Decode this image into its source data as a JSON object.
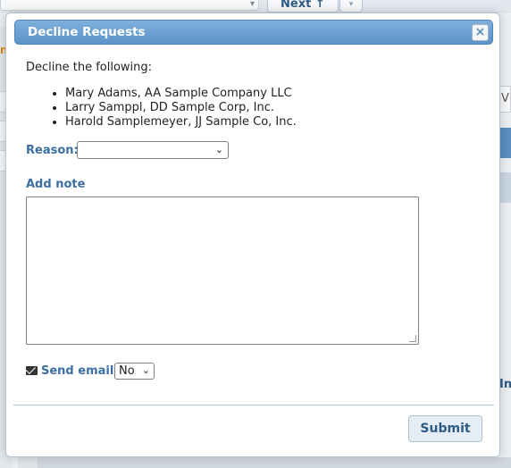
{
  "background": {
    "next_label": "Next",
    "left_orange_text": "ng",
    "right_box_text": "V",
    "right_link_text": "In"
  },
  "modal": {
    "title": "Decline Requests",
    "close_glyph": "×",
    "intro": "Decline the following:",
    "items": [
      "Mary Adams, AA Sample Company LLC",
      "Larry Samppl, DD Sample Corp, Inc.",
      "Harold Samplemeyer, JJ Sample Co, Inc."
    ],
    "reason_label": "Reason:",
    "reason_value": "",
    "note_label": "Add note",
    "note_value": "",
    "email_label": "Send email:",
    "email_value": "No",
    "submit_label": "Submit"
  },
  "colors": {
    "header_blue": "#5b92c8",
    "label_blue": "#3b6fa1",
    "accent_orange": "#e38a1c"
  },
  "icons": {
    "email": "envelope-icon",
    "close": "close-icon",
    "dropdown": "chevron-down-icon"
  }
}
